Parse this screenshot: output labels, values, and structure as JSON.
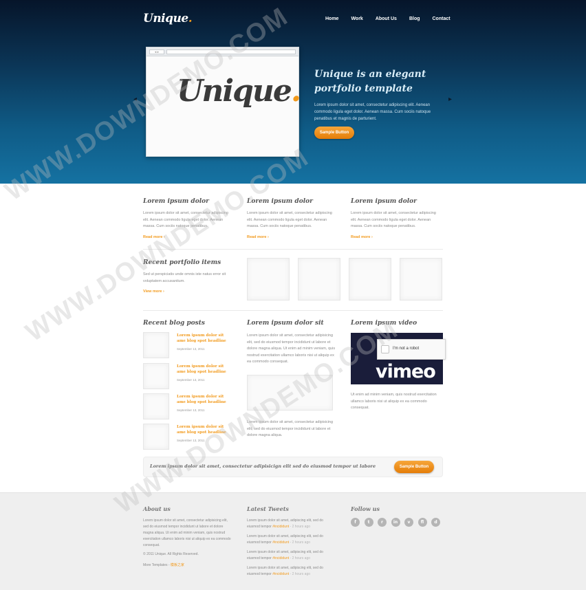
{
  "header": {
    "logo_text": "Unique",
    "logo_dot": ".",
    "nav": [
      "Home",
      "Work",
      "About Us",
      "Blog",
      "Contact"
    ]
  },
  "hero": {
    "browser_buttons": "◂ ▸",
    "showcase_logo": "Unique",
    "showcase_dot": ".",
    "title": "Unique is an elegant portfolio template",
    "text": "Lorem ipsum dolor sit amet, consectetur adipiscing elit. Aenean commodo ligula eget dolor. Aenean massa. Cum sociis natoque penatibus et magnis de parturient.",
    "button": "Sample Button",
    "prev_arrow": "◂",
    "next_arrow": "▸"
  },
  "features": [
    {
      "title": "Lorem ipsum dolor",
      "text": "Lorem ipsum dolor sit amet, consectetur adipiscing elit. Aenean commodo ligula eget dolor. Aenean massa. Cum sociis natoque penatibus.",
      "link": "Read more"
    },
    {
      "title": "Lorem ipsum dolor",
      "text": "Lorem ipsum dolor sit amet, consectetur adipiscing elit. Aenean commodo ligula eget dolor. Aenean massa. Cum sociis natoque penatibus.",
      "link": "Read more"
    },
    {
      "title": "Lorem ipsum dolor",
      "text": "Lorem ipsum dolor sit amet, consectetur adipiscing elit. Aenean commodo ligula eget dolor. Aenean massa. Cum sociis natoque penatibus.",
      "link": "Read more"
    }
  ],
  "portfolio": {
    "title": "Recent portfolio items",
    "text": "Sed ut perspiciatis unde omnis iste natus error sit voluptatem accusantium.",
    "link": "View more"
  },
  "blog": {
    "title": "Recent blog posts",
    "posts": [
      {
        "title": "Lorem ipsum dolor sit ame blog spot headline",
        "date": "September 13, 2011"
      },
      {
        "title": "Lorem ipsum dolor sit ame blog spot headline",
        "date": "September 13, 2011"
      },
      {
        "title": "Lorem ipsum dolor sit ame blog spot headline",
        "date": "September 13, 2011"
      },
      {
        "title": "Lorem ipsum dolor sit ame blog spot headline",
        "date": "September 13, 2011"
      }
    ]
  },
  "middle": {
    "title": "Lorem ipsum dolor sit",
    "text1": "Lorem ipsum dolor sit amet, consectetur adipisicing elit, sed do eiusmod tempor incididunt ut labore et dolore magna aliqua. Ut enim ad minim veniam, quis nostrud exercitation ullamco laboris nisi ut aliquip ex ea commodo consequat.",
    "text2": "Lorem ipsum dolor sit amet, consectetur adipisicing elit, sed do eiusmod tempor incididunt ut labore et dolore magna aliqua."
  },
  "video": {
    "title": "Lorem ipsum video",
    "captcha_label": "I'm not a robot",
    "brand": "vimeo",
    "text": "Ut enim ad minim veniam, quis nostrud exercitation ullamco laboris nisi ut aliquip ex ea commodo consequat."
  },
  "banner": {
    "text": "Lorem ipsum dolor sit amet, consectetur adipisicign elit sed do eiusmod tempor ut labore",
    "button": "Sample Button"
  },
  "footer": {
    "about_title": "About us",
    "about_text": "Lorem ipsum dolor sit amet, consectetur adipisicing elit, sed do eiusmod tempor incididunt ut labore et dolore magna aliqua. Ut enim ad minim veniam, quis nostrud exercitation ullamco laboris nisi ut aliquip ex ea commodo consequat.",
    "copyright": "© 2011 Unique. All Rights Reserved.",
    "more_templates_label": "More Templates - ",
    "more_templates_link": "模板之家",
    "tweets_title": "Latest Tweets",
    "tweets": [
      {
        "text": "Lorem ipsum dolor sit amet, adipiscing elit, sed do eiusmod tempor ",
        "tag": "#incididunt",
        "time": " - 2 hours ago"
      },
      {
        "text": "Lorem ipsum dolor sit amet, adipiscing elit, sed do eiusmod tempor ",
        "tag": "#incididunt",
        "time": " - 2 hours ago"
      },
      {
        "text": "Lorem ipsum dolor sit amet, adipiscing elit, sed do eiusmod tempor ",
        "tag": "#incididunt",
        "time": " - 2 hours ago"
      },
      {
        "text": "Lorem ipsum dolor sit amet, adipiscing elit, sed do eiusmod tempor ",
        "tag": "#incididunt",
        "time": " - 2 hours ago"
      }
    ],
    "follow_title": "Follow us",
    "social_icons": [
      "facebook-icon",
      "twitter-icon",
      "rss-icon",
      "linkedin-icon",
      "vimeo-icon",
      "flickr-icon",
      "dribbble-icon"
    ],
    "social_glyphs": [
      "f",
      "t",
      "r",
      "in",
      "v",
      "fl",
      "d"
    ]
  },
  "watermark": "WWW.DOWNDEMO.COM",
  "colors": {
    "accent": "#f29a1c",
    "hero_top": "#06152a",
    "hero_bottom": "#1572a2",
    "footer_bg": "#efefef"
  }
}
